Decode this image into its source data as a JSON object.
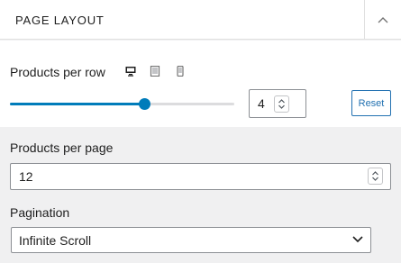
{
  "panel": {
    "title": "Page layout"
  },
  "products_per_row": {
    "label": "Products per row",
    "value": "4",
    "slider_fraction": 0.6,
    "reset_label": "Reset",
    "devices": [
      "desktop-icon",
      "tablet-icon",
      "mobile-icon"
    ]
  },
  "products_per_page": {
    "label": "Products per page",
    "value": "12"
  },
  "pagination": {
    "label": "Pagination",
    "selected": "Infinite Scroll"
  },
  "colors": {
    "accent": "#007cba",
    "link": "#2271b1",
    "panel_bg": "#f0f0f1"
  }
}
